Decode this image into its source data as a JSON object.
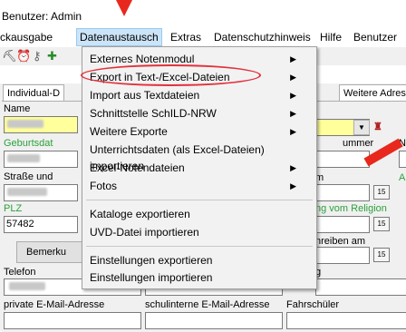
{
  "window": {
    "title": "Benutzer: Admin"
  },
  "menubar": {
    "items": [
      "ckausgabe",
      "Datenaustausch",
      "Extras",
      "Datenschutzhinweis",
      "Hilfe",
      "Benutzer"
    ]
  },
  "toolbar": {
    "icons": [
      "person-icon",
      "alarm-icon",
      "key-icon",
      "tool-icon"
    ]
  },
  "tabs": {
    "left": "Individual-D",
    "right": "Weitere Adres"
  },
  "form": {
    "name_label": "Name",
    "geburtsdatum_label": "Geburtsdat",
    "strasse_label": "Straße und",
    "plz_label": "PLZ",
    "plz_value": "57482",
    "bemerk_button": "Bemerku",
    "telefon_label": "Telefon",
    "private_email_label": "private E-Mail-Adresse",
    "schul_email_label": "schulinterne E-Mail-Adresse",
    "fahrschueler_label": "Fahrschüler",
    "nummer_label": "ummer",
    "n_label": "N",
    "m_label": "m",
    "religion_label": "ng vom Religion",
    "schreiben_label": "nreiben am",
    "g_label": "g",
    "a_label": "A"
  },
  "dropdown_menu": {
    "items": [
      {
        "label": "Externes Notenmodul",
        "submenu": true
      },
      {
        "label": "Export in Text-/Excel-Dateien",
        "submenu": true,
        "highlighted": true
      },
      {
        "label": "Import aus Textdateien",
        "submenu": true
      },
      {
        "label": "Schnittstelle SchILD-NRW",
        "submenu": true
      },
      {
        "label": "Weitere Exporte",
        "submenu": true
      },
      {
        "label": "Unterrichtsdaten (als Excel-Dateien) importieren",
        "submenu": false
      },
      {
        "label": "Excel-Notendateien",
        "submenu": true
      },
      {
        "label": "Fotos",
        "submenu": true
      },
      {
        "label": "Kataloge exportieren",
        "submenu": false
      },
      {
        "label": "UVD-Datei importieren",
        "submenu": false
      },
      {
        "label": "Einstellungen exportieren",
        "submenu": false
      },
      {
        "label": "Einstellungen importieren",
        "submenu": false
      }
    ],
    "submenu_arrow": "▶"
  },
  "colors": {
    "highlight_ellipse": "#e2313b",
    "annotation_arrow": "#e8281d",
    "menu_active": "#cce4f7",
    "green_label": "#2aa23a",
    "name_field": "#ffff9c"
  }
}
